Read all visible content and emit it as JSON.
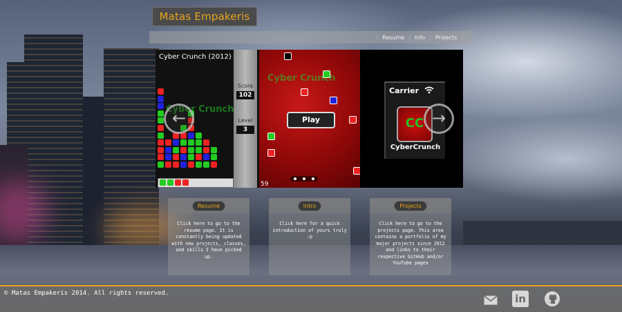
{
  "header": {
    "site_title": "Matas Empakeris",
    "nav": [
      "Resume",
      "Info",
      "Projects"
    ]
  },
  "slideshow": {
    "game_title": "Cyber Crunch (2012)",
    "score_label": "Score",
    "score_value": "102",
    "level_label": "Level",
    "level_value": "3",
    "ghost_title": "Cyber Crunch",
    "play_label": "Play",
    "bottom_number": "59",
    "carrier_label": "Carrier",
    "app_icon_text": "CC",
    "app_name": "CyberCrunch",
    "prev_glyph": "←",
    "next_glyph": "→"
  },
  "cards": [
    {
      "label": "Resume",
      "text": "Click here to go to the resume page. It is constantly being updated with new projects, classes, and skills I have picked up."
    },
    {
      "label": "Intro",
      "text": "Click here for a quick introduction of yours truly :p"
    },
    {
      "label": "Projects",
      "text": "Click here to go to the projects page. This area contains a portfolio of my major projects since 2012 and links to their respective GitHub and/or YouTube pages"
    }
  ],
  "footer": {
    "copyright": "© Matas Empakeris 2014. All rights reserved.",
    "icons": [
      "mail-icon",
      "linkedin-icon",
      "github-icon"
    ],
    "linkedin_glyph": "in"
  },
  "colors": {
    "accent": "#e8a41d",
    "footer_bg": "#696969"
  }
}
